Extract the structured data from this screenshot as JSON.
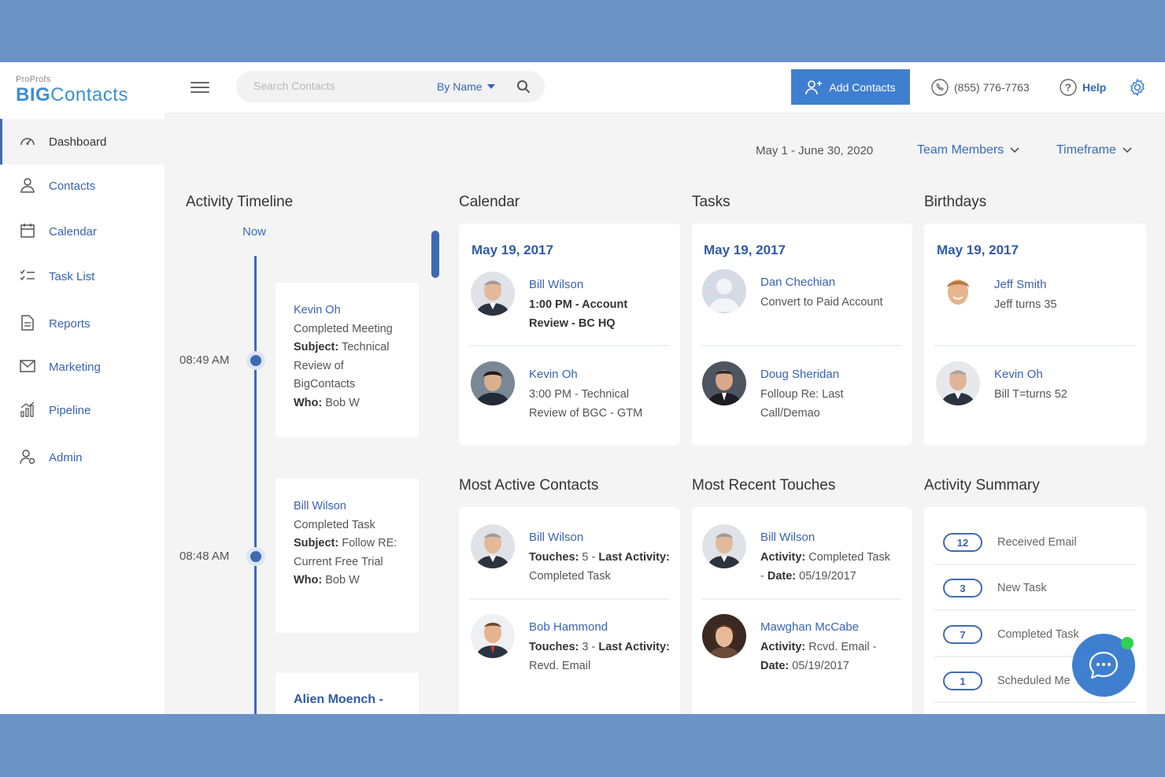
{
  "header": {
    "logo_top": "ProProfs",
    "logo_big": "BIG",
    "logo_contacts": "Contacts",
    "search_placeholder": "Search Contacts",
    "search_mode": "By Name",
    "add_contacts": "Add Contacts",
    "phone": "(855) 776-7763",
    "help": "Help"
  },
  "sidebar": {
    "items": [
      {
        "label": "Dashboard",
        "icon": "gauge-icon"
      },
      {
        "label": "Contacts",
        "icon": "user-icon"
      },
      {
        "label": "Calendar",
        "icon": "calendar-icon"
      },
      {
        "label": "Task List",
        "icon": "checklist-icon"
      },
      {
        "label": "Reports",
        "icon": "document-icon"
      },
      {
        "label": "Marketing",
        "icon": "envelope-icon"
      },
      {
        "label": "Pipeline",
        "icon": "bar-chart-icon"
      },
      {
        "label": "Admin",
        "icon": "admin-user-icon"
      }
    ]
  },
  "filters": {
    "date_range": "May 1 - June 30, 2020",
    "team_members": "Team Members",
    "timeframe": "Timeframe"
  },
  "timeline": {
    "title": "Activity Timeline",
    "now": "Now",
    "items": [
      {
        "time": "08:49 AM",
        "name": "Kevin Oh",
        "action": "Completed Meeting",
        "subject_label": "Subject:",
        "subject_1": " Technical",
        "subject_2": "Review of",
        "subject_3": "BigContacts",
        "who_label": "Who:",
        "who": " Bob W"
      },
      {
        "time": "08:48 AM",
        "name": "Bill Wilson",
        "action": "Completed Task",
        "subject_label": "Subject:",
        "subject_1": " Follow RE:",
        "subject_2": "Current Free Trial",
        "who_label": "Who:",
        "who": " Bob W"
      },
      {
        "name": "Alien Moench -"
      }
    ]
  },
  "calendar": {
    "title": "Calendar",
    "date": "May 19, 2017",
    "entries": [
      {
        "name": "Bill Wilson",
        "line1": "1:00 PM - Account",
        "line2": "Review - BC HQ"
      },
      {
        "name": "Kevin Oh",
        "line1": "3:00 PM - Technical",
        "line2": "Review of BGC - GTM"
      }
    ]
  },
  "tasks": {
    "title": "Tasks",
    "date": "May 19, 2017",
    "entries": [
      {
        "name": "Dan Chechian",
        "line1": "Convert to Paid Account"
      },
      {
        "name": "Doug Sheridan",
        "line1": "Folloup Re: Last",
        "line2": "Call/Demao"
      }
    ]
  },
  "birthdays": {
    "title": "Birthdays",
    "date": "May 19, 2017",
    "entries": [
      {
        "name": "Jeff Smith",
        "line1": "Jeff turns 35"
      },
      {
        "name": "Kevin Oh",
        "line1": "Bill T=turns 52"
      }
    ]
  },
  "most_active": {
    "title": "Most Active Contacts",
    "entries": [
      {
        "name": "Bill Wilson",
        "label": "Touches:",
        "line1": " 5 - ",
        "label2": "Last Activity:",
        "line2": "Completed Task"
      },
      {
        "name": "Bob Hammond",
        "label": "Touches:",
        "line1": " 3 - ",
        "label2": "Last Activity:",
        "line2": "Revd. Email"
      }
    ]
  },
  "recent_touches": {
    "title": "Most Recent Touches",
    "entries": [
      {
        "name": "Bill Wilson",
        "label": "Activity:",
        "line1": " Completed Task",
        "line2_pre": " - ",
        "label2": "Date:",
        "line2": " 05/19/2017"
      },
      {
        "name": "Mawghan McCabe",
        "label": "Activity:",
        "line1": " Rcvd. Email  -",
        "label2": "Date:",
        "line2": " 05/19/2017"
      }
    ]
  },
  "activity_summary": {
    "title": "Activity Summary",
    "rows": [
      {
        "count": "12",
        "label": "Received Email"
      },
      {
        "count": "3",
        "label": "New Task"
      },
      {
        "count": "7",
        "label": "Completed Task"
      },
      {
        "count": "1",
        "label": "Scheduled Me"
      }
    ]
  },
  "colors": {
    "accent": "#3f6ab3",
    "button": "#3f7fd0",
    "frame": "#6d93c6",
    "online": "#2fd34f"
  }
}
